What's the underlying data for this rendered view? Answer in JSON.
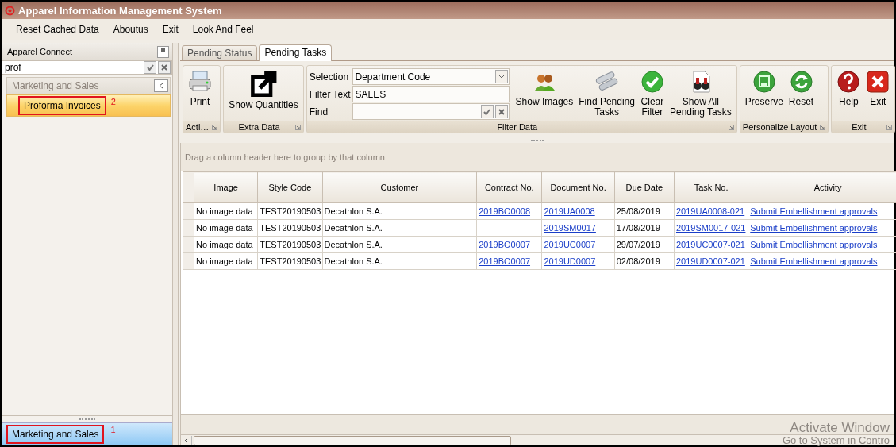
{
  "window": {
    "title": "Apparel Information Management System"
  },
  "menu": [
    "Reset Cached Data",
    "Aboutus",
    "Exit",
    "Look And Feel"
  ],
  "sidebar": {
    "title": "Apparel Connect",
    "search": {
      "value": "prof"
    },
    "group": {
      "label": "Marketing and Sales"
    },
    "items": [
      {
        "label": "Proforma Invoices",
        "selected": true,
        "annotation": "2"
      }
    ],
    "bottom_group": {
      "label": "Marketing and Sales",
      "selected": true,
      "annotation": "1"
    }
  },
  "tabs": [
    {
      "label": "Pending Status",
      "selected": false
    },
    {
      "label": "Pending Tasks",
      "selected": true
    }
  ],
  "ribbon": {
    "groups": [
      {
        "caption": "Acti…",
        "buttons": [
          {
            "label": "Print"
          }
        ]
      },
      {
        "caption": "Extra Data",
        "buttons": [
          {
            "label": "Show Quantities"
          }
        ]
      },
      {
        "caption": "Filter Data",
        "fields": [
          {
            "label": "Selection",
            "kind": "dropdown",
            "value": "Department Code"
          },
          {
            "label": "Filter Text",
            "kind": "text",
            "value": "SALES"
          },
          {
            "label": "Find",
            "kind": "find"
          }
        ],
        "buttons": [
          {
            "label": "Show Images"
          },
          {
            "label": "Find Pending\nTasks"
          },
          {
            "label": "Clear\nFilter"
          },
          {
            "label": "Show All\nPending Tasks"
          }
        ]
      },
      {
        "caption": "Personalize Layout",
        "buttons": [
          {
            "label": "Preserve"
          },
          {
            "label": "Reset"
          }
        ]
      },
      {
        "caption": "Exit",
        "buttons": [
          {
            "label": "Help"
          },
          {
            "label": "Exit"
          }
        ]
      }
    ]
  },
  "grid": {
    "group_panel": "Drag a column header here to group by that column",
    "columns": [
      {
        "label": "Image",
        "kind": "text"
      },
      {
        "label": "Style Code",
        "kind": "text"
      },
      {
        "label": "Customer",
        "kind": "text"
      },
      {
        "label": "Contract No.",
        "kind": "link"
      },
      {
        "label": "Document No.",
        "kind": "link"
      },
      {
        "label": "Due Date",
        "kind": "text"
      },
      {
        "label": "Task No.",
        "kind": "link"
      },
      {
        "label": "Activity",
        "kind": "link"
      }
    ],
    "rows": [
      [
        "No image data",
        "TEST20190503",
        "Decathlon S.A.",
        "2019BO0008",
        "2019UA0008",
        "25/08/2019",
        "2019UA0008-021",
        "Submit Embellishment approvals"
      ],
      [
        "No image data",
        "TEST20190503",
        "Decathlon S.A.",
        null,
        "2019SM0017",
        "17/08/2019",
        "2019SM0017-021",
        "Submit Embellishment approvals"
      ],
      [
        "No image data",
        "TEST20190503",
        "Decathlon S.A.",
        "2019BO0007",
        "2019UC0007",
        "29/07/2019",
        "2019UC0007-021",
        "Submit Embellishment approvals"
      ],
      [
        "No image data",
        "TEST20190503",
        "Decathlon S.A.",
        "2019BO0007",
        "2019UD0007",
        "02/08/2019",
        "2019UD0007-021",
        "Submit Embellishment approvals"
      ]
    ]
  },
  "activation_notice": [
    "Activate Window",
    "Go to System in Contro"
  ]
}
